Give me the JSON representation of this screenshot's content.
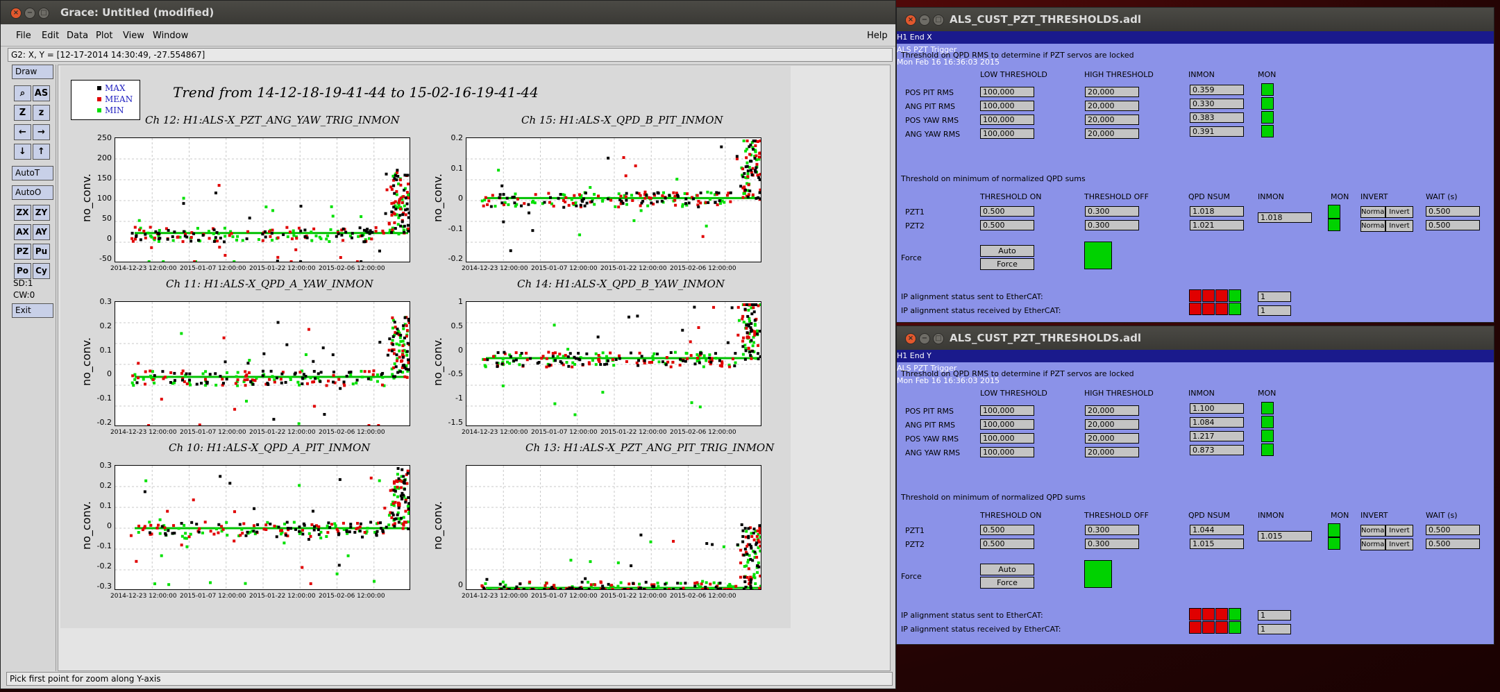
{
  "grace": {
    "title": "Grace: Untitled (modified)",
    "menu": [
      "File",
      "Edit",
      "Data",
      "Plot",
      "View",
      "Window",
      "Help"
    ],
    "locator": "G2: X, Y = [12-17-2014 14:30:49, -27.554867]",
    "status": "Pick first point for zoom along Y-axis",
    "toolbar": {
      "draw": "Draw",
      "tiles": [
        [
          "⌕",
          "AS"
        ],
        [
          "Z",
          "z"
        ],
        [
          "←",
          "→"
        ],
        [
          "↓",
          "↑"
        ]
      ],
      "autot": "AutoT",
      "autoo": "AutoO",
      "pairs": [
        [
          "ZX",
          "ZY"
        ],
        [
          "AX",
          "AY"
        ],
        [
          "PZ",
          "Pu"
        ],
        [
          "Po",
          "Cy"
        ]
      ],
      "sd": "SD:1",
      "cw": "CW:0",
      "exit": "Exit"
    },
    "legend": [
      {
        "label": "MAX",
        "color": "#000000"
      },
      {
        "label": "MEAN",
        "color": "#e00000"
      },
      {
        "label": "MIN",
        "color": "#00e000"
      }
    ],
    "plot_title": "Trend from 14-12-18-19-41-44 to 15-02-16-19-41-44",
    "xticks": [
      "2014-12-23 12:00:00",
      "2015-01-07 12:00:00",
      "2015-01-22 12:00:00",
      "2015-02-06 12:00:00"
    ]
  },
  "chart_data": [
    {
      "type": "scatter",
      "title": "Ch 12: H1:ALS-X_PZT_ANG_YAW_TRIG_INMON",
      "ylabel": "no_conv.",
      "ylim": [
        -50,
        250
      ],
      "yticks": [
        "250",
        "200",
        "150",
        "100",
        "50",
        "0",
        "-50"
      ],
      "series": [
        {
          "name": "MAX"
        },
        {
          "name": "MEAN"
        },
        {
          "name": "MIN"
        }
      ]
    },
    {
      "type": "scatter",
      "title": "Ch 15: H1:ALS-X_QPD_B_PIT_INMON",
      "ylabel": "no_conv.",
      "ylim": [
        -0.25,
        0.25
      ],
      "yticks": [
        "0.2",
        "0.1",
        "0",
        "-0.1",
        "-0.2"
      ],
      "series": [
        {
          "name": "MAX"
        },
        {
          "name": "MEAN"
        },
        {
          "name": "MIN"
        }
      ]
    },
    {
      "type": "scatter",
      "title": "Ch 11: H1:ALS-X_QPD_A_YAW_INMON",
      "ylabel": "no_conv.",
      "ylim": [
        -0.2,
        0.3
      ],
      "yticks": [
        "0.3",
        "0.2",
        "0.1",
        "0",
        "-0.1",
        "-0.2"
      ],
      "series": [
        {
          "name": "MAX"
        },
        {
          "name": "MEAN"
        },
        {
          "name": "MIN"
        }
      ]
    },
    {
      "type": "scatter",
      "title": "Ch 14: H1:ALS-X_QPD_B_YAW_INMON",
      "ylabel": "no_conv.",
      "ylim": [
        -1.5,
        1.25
      ],
      "yticks": [
        "1",
        "0.5",
        "0",
        "-0.5",
        "-1",
        "-1.5"
      ],
      "series": [
        {
          "name": "MAX"
        },
        {
          "name": "MEAN"
        },
        {
          "name": "MIN"
        }
      ]
    },
    {
      "type": "scatter",
      "title": "Ch 10: H1:ALS-X_QPD_A_PIT_INMON",
      "ylabel": "no_conv.",
      "ylim": [
        -0.35,
        0.35
      ],
      "yticks": [
        "0.3",
        "0.2",
        "0.1",
        "0",
        "-0.1",
        "-0.2",
        "-0.3"
      ],
      "series": [
        {
          "name": "MAX"
        },
        {
          "name": "MEAN"
        },
        {
          "name": "MIN"
        }
      ]
    },
    {
      "type": "scatter",
      "title": "Ch 13: H1:ALS-X_PZT_ANG_PIT_TRIG_INMON",
      "ylabel": "no_conv.",
      "ylim": [
        0,
        1
      ],
      "yticks": [
        "0"
      ],
      "series": [
        {
          "name": "MAX"
        },
        {
          "name": "MEAN"
        },
        {
          "name": "MIN"
        }
      ]
    }
  ],
  "medm": [
    {
      "title": "ALS_CUST_PZT_THRESHOLDS.adl",
      "hdr_left": "H1 End X",
      "hdr_center": "ALS PZT Trigger",
      "hdr_right": "Mon Feb 16 16:36:03 2015",
      "sec1": "Threshold on QPD RMS to determine if PZT servos are locked",
      "cols1": [
        "LOW THRESHOLD",
        "HIGH THRESHOLD",
        "INMON",
        "MON"
      ],
      "rows1": [
        [
          "POS PIT RMS",
          "100,000",
          "20,000",
          "0.359"
        ],
        [
          "ANG PIT RMS",
          "100,000",
          "20,000",
          "0.330"
        ],
        [
          "POS YAW RMS",
          "100,000",
          "20,000",
          "0.383"
        ],
        [
          "ANG YAW RMS",
          "100,000",
          "20,000",
          "0.391"
        ]
      ],
      "sec2": "Threshold on minimum of normalized QPD sums",
      "cols2": [
        "THRESHOLD ON",
        "THRESHOLD OFF",
        "QPD NSUM",
        "INMON",
        "MON",
        "INVERT",
        "WAIT (s)"
      ],
      "rows2": [
        [
          "PZT1",
          "0.500",
          "0.300",
          "1.018",
          "Normal",
          "Invert",
          "0.500"
        ],
        [
          "PZT2",
          "0.500",
          "0.300",
          "1.021",
          "Normal",
          "Invert",
          "0.500"
        ]
      ],
      "inmon2": "1.018",
      "force_label": "Force",
      "auto_btn": "Auto",
      "force_btn": "Force",
      "ip_sent": "IP alignment status sent to EtherCAT:",
      "ip_recv": "IP alignment status received by EtherCAT:",
      "ip_sent_val": "1",
      "ip_recv_val": "1"
    },
    {
      "title": "ALS_CUST_PZT_THRESHOLDS.adl",
      "hdr_left": "H1 End Y",
      "hdr_center": "ALS PZT Trigger",
      "hdr_right": "Mon Feb 16 16:36:03 2015",
      "sec1": "Threshold on QPD RMS to determine if PZT servos are locked",
      "cols1": [
        "LOW THRESHOLD",
        "HIGH THRESHOLD",
        "INMON",
        "MON"
      ],
      "rows1": [
        [
          "POS PIT RMS",
          "100,000",
          "20,000",
          "1.100"
        ],
        [
          "ANG PIT RMS",
          "100,000",
          "20,000",
          "1.084"
        ],
        [
          "POS YAW RMS",
          "100,000",
          "20,000",
          "1.217"
        ],
        [
          "ANG YAW RMS",
          "100,000",
          "20,000",
          "0.873"
        ]
      ],
      "sec2": "Threshold on minimum of normalized QPD sums",
      "cols2": [
        "THRESHOLD ON",
        "THRESHOLD OFF",
        "QPD NSUM",
        "INMON",
        "MON",
        "INVERT",
        "WAIT (s)"
      ],
      "rows2": [
        [
          "PZT1",
          "0.500",
          "0.300",
          "1.044",
          "Normal",
          "Invert",
          "0.500"
        ],
        [
          "PZT2",
          "0.500",
          "0.300",
          "1.015",
          "Normal",
          "Invert",
          "0.500"
        ]
      ],
      "inmon2": "1.015",
      "force_label": "Force",
      "auto_btn": "Auto",
      "force_btn": "Force",
      "ip_sent": "IP alignment status sent to EtherCAT:",
      "ip_recv": "IP alignment status received by EtherCAT:",
      "ip_sent_val": "1",
      "ip_recv_val": "1"
    }
  ]
}
